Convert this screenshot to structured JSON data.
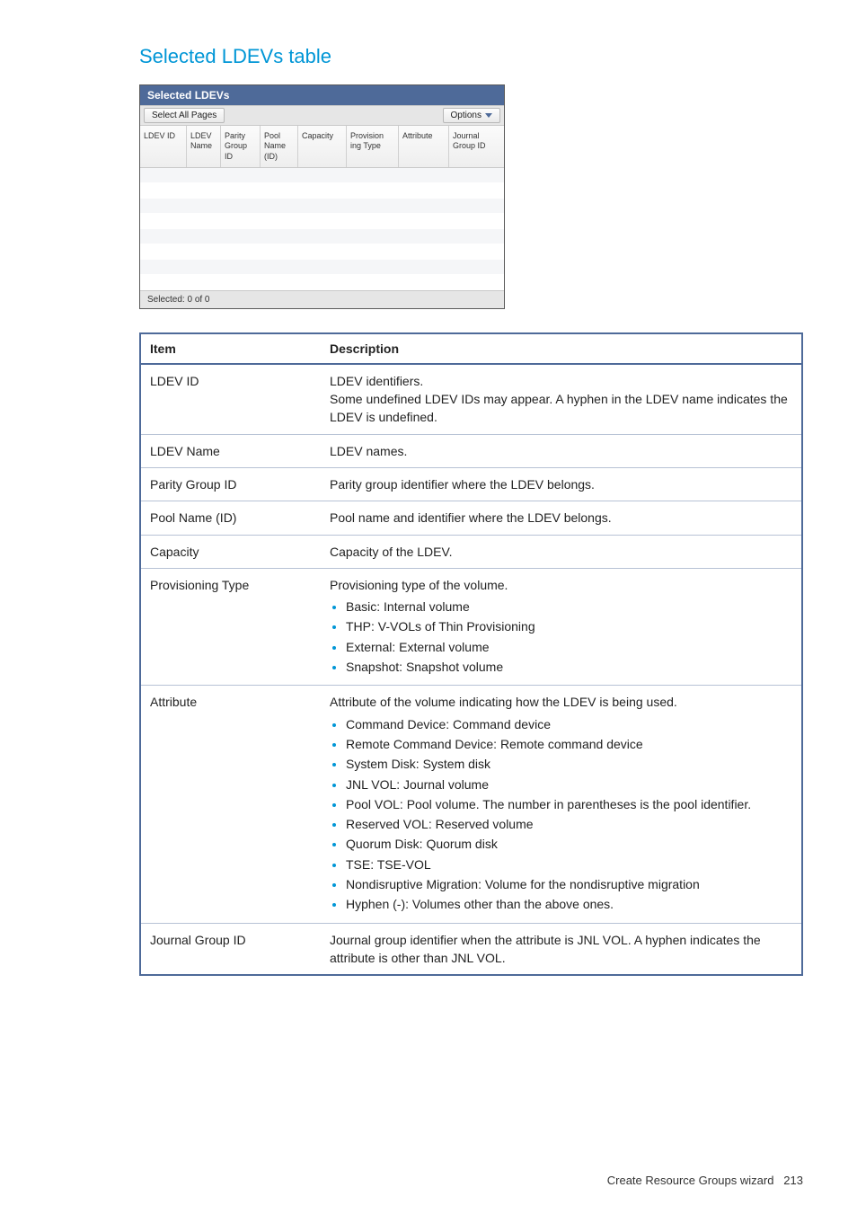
{
  "heading": "Selected LDEVs table",
  "panel": {
    "title": "Selected LDEVs",
    "select_all_label": "Select All Pages",
    "options_label": "Options",
    "columns": [
      "LDEV ID",
      "LDEV Name",
      "Parity Group ID",
      "Pool Name (ID)",
      "Capacity",
      "Provision ing Type",
      "Attribute",
      "Journal Group ID"
    ],
    "footer": "Selected:  0    of  0"
  },
  "desc_header": {
    "item": "Item",
    "description": "Description"
  },
  "rows": [
    {
      "item": "LDEV ID",
      "desc": "LDEV identifiers.\nSome undefined LDEV IDs may appear. A hyphen in the LDEV name indicates the LDEV is undefined."
    },
    {
      "item": "LDEV Name",
      "desc": "LDEV names."
    },
    {
      "item": "Parity Group ID",
      "desc": "Parity group identifier where the LDEV belongs."
    },
    {
      "item": "Pool Name (ID)",
      "desc": "Pool name and identifier where the LDEV belongs."
    },
    {
      "item": "Capacity",
      "desc": "Capacity of the LDEV."
    },
    {
      "item": "Provisioning Type",
      "desc": "Provisioning type of the volume.",
      "bullets": [
        "Basic: Internal volume",
        "THP: V-VOLs of Thin Provisioning",
        "External: External volume",
        "Snapshot: Snapshot volume"
      ]
    },
    {
      "item": "Attribute",
      "desc": "Attribute of the volume indicating how the LDEV is being used.",
      "bullets": [
        "Command Device: Command device",
        "Remote Command Device: Remote command device",
        "System Disk: System disk",
        "JNL VOL: Journal volume",
        "Pool VOL: Pool volume. The number in parentheses is the pool identifier.",
        "Reserved VOL: Reserved volume",
        "Quorum Disk: Quorum disk",
        "TSE: TSE-VOL",
        "Nondisruptive Migration: Volume for the nondisruptive migration",
        "Hyphen (-): Volumes other than the above ones."
      ]
    },
    {
      "item": "Journal Group ID",
      "desc": "Journal group identifier when the attribute is JNL VOL. A hyphen indicates the attribute is other than JNL VOL."
    }
  ],
  "footer": {
    "text": "Create Resource Groups wizard",
    "page": "213"
  }
}
